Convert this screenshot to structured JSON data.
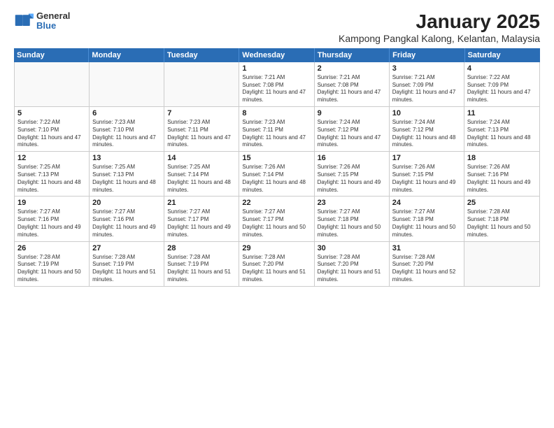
{
  "logo": {
    "line1": "General",
    "line2": "Blue"
  },
  "title": "January 2025",
  "subtitle": "Kampong Pangkal Kalong, Kelantan, Malaysia",
  "weekdays": [
    "Sunday",
    "Monday",
    "Tuesday",
    "Wednesday",
    "Thursday",
    "Friday",
    "Saturday"
  ],
  "weeks": [
    [
      {
        "day": "",
        "info": ""
      },
      {
        "day": "",
        "info": ""
      },
      {
        "day": "",
        "info": ""
      },
      {
        "day": "1",
        "info": "Sunrise: 7:21 AM\nSunset: 7:08 PM\nDaylight: 11 hours and 47 minutes."
      },
      {
        "day": "2",
        "info": "Sunrise: 7:21 AM\nSunset: 7:08 PM\nDaylight: 11 hours and 47 minutes."
      },
      {
        "day": "3",
        "info": "Sunrise: 7:21 AM\nSunset: 7:09 PM\nDaylight: 11 hours and 47 minutes."
      },
      {
        "day": "4",
        "info": "Sunrise: 7:22 AM\nSunset: 7:09 PM\nDaylight: 11 hours and 47 minutes."
      }
    ],
    [
      {
        "day": "5",
        "info": "Sunrise: 7:22 AM\nSunset: 7:10 PM\nDaylight: 11 hours and 47 minutes."
      },
      {
        "day": "6",
        "info": "Sunrise: 7:23 AM\nSunset: 7:10 PM\nDaylight: 11 hours and 47 minutes."
      },
      {
        "day": "7",
        "info": "Sunrise: 7:23 AM\nSunset: 7:11 PM\nDaylight: 11 hours and 47 minutes."
      },
      {
        "day": "8",
        "info": "Sunrise: 7:23 AM\nSunset: 7:11 PM\nDaylight: 11 hours and 47 minutes."
      },
      {
        "day": "9",
        "info": "Sunrise: 7:24 AM\nSunset: 7:12 PM\nDaylight: 11 hours and 47 minutes."
      },
      {
        "day": "10",
        "info": "Sunrise: 7:24 AM\nSunset: 7:12 PM\nDaylight: 11 hours and 48 minutes."
      },
      {
        "day": "11",
        "info": "Sunrise: 7:24 AM\nSunset: 7:13 PM\nDaylight: 11 hours and 48 minutes."
      }
    ],
    [
      {
        "day": "12",
        "info": "Sunrise: 7:25 AM\nSunset: 7:13 PM\nDaylight: 11 hours and 48 minutes."
      },
      {
        "day": "13",
        "info": "Sunrise: 7:25 AM\nSunset: 7:13 PM\nDaylight: 11 hours and 48 minutes."
      },
      {
        "day": "14",
        "info": "Sunrise: 7:25 AM\nSunset: 7:14 PM\nDaylight: 11 hours and 48 minutes."
      },
      {
        "day": "15",
        "info": "Sunrise: 7:26 AM\nSunset: 7:14 PM\nDaylight: 11 hours and 48 minutes."
      },
      {
        "day": "16",
        "info": "Sunrise: 7:26 AM\nSunset: 7:15 PM\nDaylight: 11 hours and 49 minutes."
      },
      {
        "day": "17",
        "info": "Sunrise: 7:26 AM\nSunset: 7:15 PM\nDaylight: 11 hours and 49 minutes."
      },
      {
        "day": "18",
        "info": "Sunrise: 7:26 AM\nSunset: 7:16 PM\nDaylight: 11 hours and 49 minutes."
      }
    ],
    [
      {
        "day": "19",
        "info": "Sunrise: 7:27 AM\nSunset: 7:16 PM\nDaylight: 11 hours and 49 minutes."
      },
      {
        "day": "20",
        "info": "Sunrise: 7:27 AM\nSunset: 7:16 PM\nDaylight: 11 hours and 49 minutes."
      },
      {
        "day": "21",
        "info": "Sunrise: 7:27 AM\nSunset: 7:17 PM\nDaylight: 11 hours and 49 minutes."
      },
      {
        "day": "22",
        "info": "Sunrise: 7:27 AM\nSunset: 7:17 PM\nDaylight: 11 hours and 50 minutes."
      },
      {
        "day": "23",
        "info": "Sunrise: 7:27 AM\nSunset: 7:18 PM\nDaylight: 11 hours and 50 minutes."
      },
      {
        "day": "24",
        "info": "Sunrise: 7:27 AM\nSunset: 7:18 PM\nDaylight: 11 hours and 50 minutes."
      },
      {
        "day": "25",
        "info": "Sunrise: 7:28 AM\nSunset: 7:18 PM\nDaylight: 11 hours and 50 minutes."
      }
    ],
    [
      {
        "day": "26",
        "info": "Sunrise: 7:28 AM\nSunset: 7:19 PM\nDaylight: 11 hours and 50 minutes."
      },
      {
        "day": "27",
        "info": "Sunrise: 7:28 AM\nSunset: 7:19 PM\nDaylight: 11 hours and 51 minutes."
      },
      {
        "day": "28",
        "info": "Sunrise: 7:28 AM\nSunset: 7:19 PM\nDaylight: 11 hours and 51 minutes."
      },
      {
        "day": "29",
        "info": "Sunrise: 7:28 AM\nSunset: 7:20 PM\nDaylight: 11 hours and 51 minutes."
      },
      {
        "day": "30",
        "info": "Sunrise: 7:28 AM\nSunset: 7:20 PM\nDaylight: 11 hours and 51 minutes."
      },
      {
        "day": "31",
        "info": "Sunrise: 7:28 AM\nSunset: 7:20 PM\nDaylight: 11 hours and 52 minutes."
      },
      {
        "day": "",
        "info": ""
      }
    ]
  ]
}
